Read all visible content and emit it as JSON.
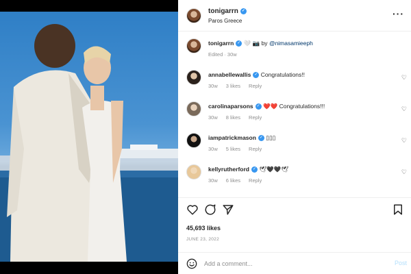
{
  "post": {
    "username": "tonigarrn",
    "location": "Paros Greece"
  },
  "caption": {
    "username": "tonigarrn",
    "text_prefix": "🤍 📷 by",
    "mention": "@nimasamieeph",
    "meta": "Edited · 30w"
  },
  "comments": [
    {
      "username": "annabellewallis",
      "verified": true,
      "text": "Congratulations!!",
      "emoji": "",
      "time": "30w",
      "likes": "3 likes",
      "reply": "Reply"
    },
    {
      "username": "carolinaparsons",
      "verified": true,
      "text": "Congratulations!!!",
      "emoji": "❤️❤️",
      "time": "30w",
      "likes": "8 likes",
      "reply": "Reply"
    },
    {
      "username": "iampatrickmason",
      "verified": true,
      "text": "▯▯▯",
      "emoji": "",
      "time": "30w",
      "likes": "5 likes",
      "reply": "Reply"
    },
    {
      "username": "kellyrutherford",
      "verified": true,
      "text": "🕊🖤🖤🕊",
      "emoji": "",
      "time": "30w",
      "likes": "6 likes",
      "reply": "Reply"
    }
  ],
  "actions": {
    "likes": "45,693 likes",
    "date": "JUNE 23, 2022"
  },
  "composer": {
    "placeholder": "Add a comment...",
    "post_label": "Post"
  },
  "colors": {
    "verified": "#3897f0",
    "link": "#00376b",
    "muted": "#8e8e8e",
    "heart": "#ed4956"
  }
}
